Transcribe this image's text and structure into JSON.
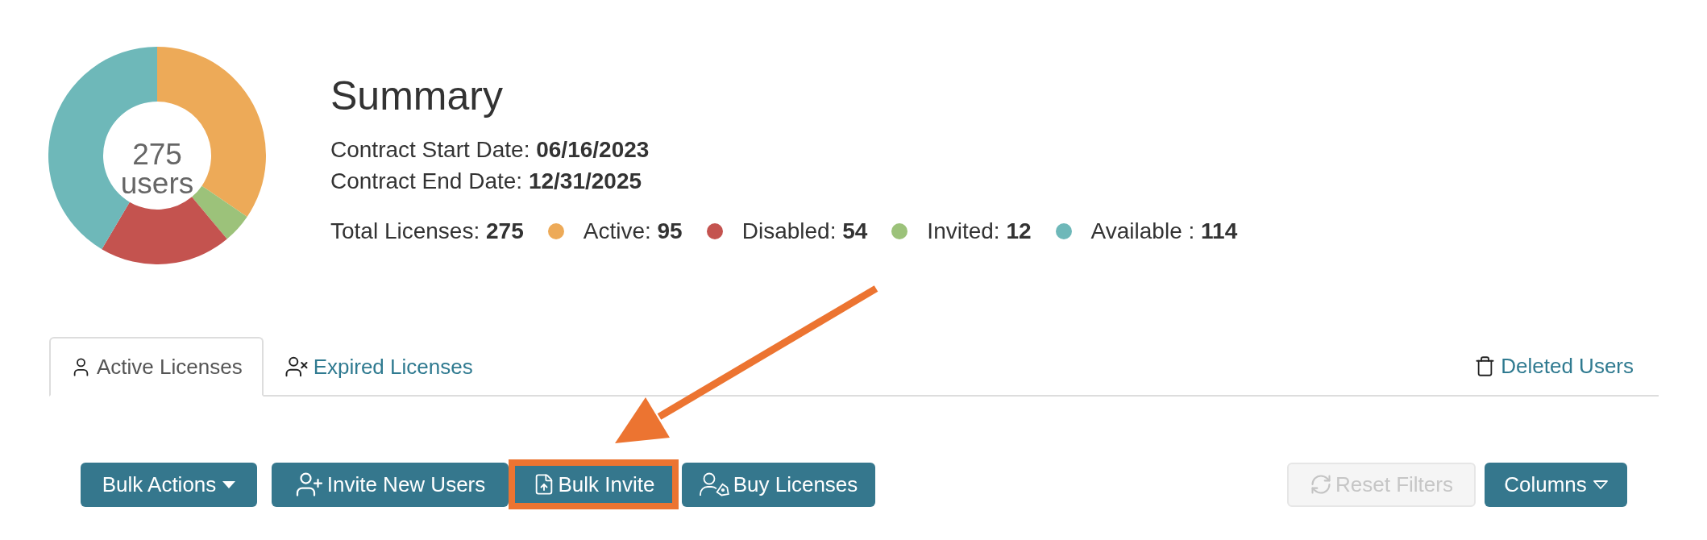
{
  "donut": {
    "center_value": "275",
    "center_label": "users",
    "chart_data": {
      "type": "donut",
      "values": [
        34.5,
        4.4,
        19.6,
        41.5
      ],
      "colors": [
        "#edaa58",
        "#9cc27a",
        "#c4534f",
        "#6eb8b9"
      ]
    }
  },
  "summary": {
    "title": "Summary",
    "contract_lines": [
      "Contract Start Date: **06/16/2023**",
      "Contract End Date: **12/31/2025**"
    ],
    "total": "Total Licenses: **275**",
    "legend": [
      {
        "text": "Active: **95**",
        "color": "#edaa58"
      },
      {
        "text": "Disabled: **54**",
        "color": "#c4534f"
      },
      {
        "text": "Invited: **12**",
        "color": "#9cc27a"
      },
      {
        "text": "Available : **114**",
        "color": "#6eb8b9"
      }
    ]
  },
  "tabs": [
    {
      "label": "Active Licenses",
      "kind": "user",
      "selected": true
    },
    {
      "label": "Expired Licenses",
      "kind": "user-x",
      "selected": false
    }
  ],
  "deleted_users": {
    "label": "Deleted Users"
  },
  "toolbar": {
    "left": [
      {
        "label": "Bulk Actions",
        "kind": "dropdown",
        "highlighted": false
      },
      {
        "label": "Invite New Users",
        "kind": "invite",
        "highlighted": false
      },
      {
        "label": "Bulk Invite",
        "kind": "upload",
        "highlighted": true
      },
      {
        "label": "Buy Licenses",
        "kind": "buy",
        "highlighted": false
      }
    ],
    "right": [
      {
        "label": "Reset Filters",
        "kind": "reset",
        "disabled": true
      },
      {
        "label": "Columns",
        "kind": "columns",
        "disabled": false
      }
    ]
  }
}
